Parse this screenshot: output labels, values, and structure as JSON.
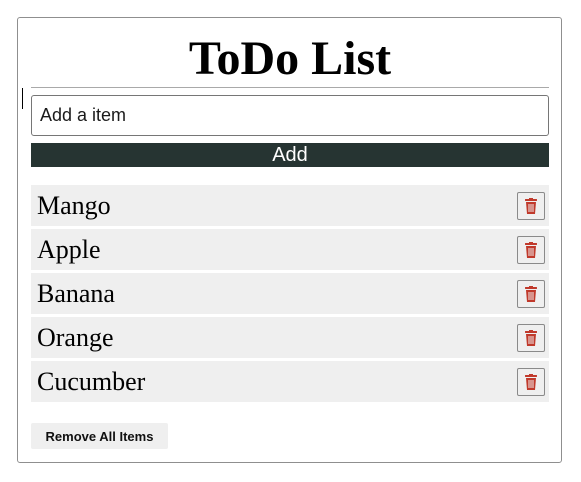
{
  "app": {
    "title": "ToDo List"
  },
  "form": {
    "input_value": "",
    "input_placeholder": "Add a item",
    "add_label": "Add"
  },
  "items": [
    {
      "label": "Mango"
    },
    {
      "label": "Apple"
    },
    {
      "label": "Banana"
    },
    {
      "label": "Orange"
    },
    {
      "label": "Cucumber"
    }
  ],
  "delete_icon": "trash-icon",
  "remove_all_label": "Remove All Items",
  "colors": {
    "add_button_bg": "#263432",
    "trash_icon": "#c0392b",
    "item_bg": "#efefef"
  }
}
